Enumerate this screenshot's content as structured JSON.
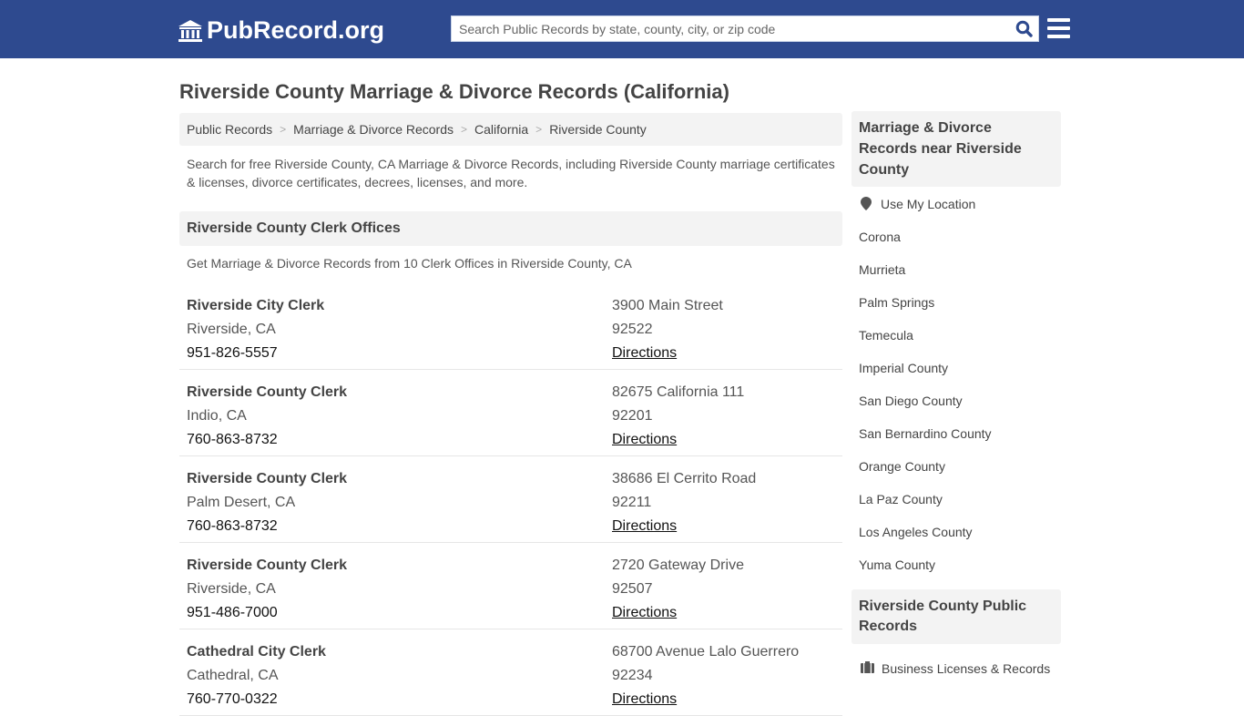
{
  "header": {
    "logo_text": "PubRecord.org",
    "search_placeholder": "Search Public Records by state, county, city, or zip code",
    "search_value": ""
  },
  "page_title": "Riverside County Marriage & Divorce Records (California)",
  "breadcrumb": [
    "Public Records",
    "Marriage & Divorce Records",
    "California",
    "Riverside County"
  ],
  "intro": "Search for free Riverside County, CA Marriage & Divorce Records, including Riverside County marriage certificates & licenses, divorce certificates, decrees, licenses, and more.",
  "clerk_section": {
    "title": "Riverside County Clerk Offices",
    "subtitle": "Get Marriage & Divorce Records from 10 Clerk Offices in Riverside County, CA",
    "offices": [
      {
        "name": "Riverside City Clerk",
        "city": "Riverside, CA",
        "phone": "951-826-5557",
        "address": "3900 Main Street",
        "zip": "92522",
        "link": "Directions"
      },
      {
        "name": "Riverside County Clerk",
        "city": "Indio, CA",
        "phone": "760-863-8732",
        "address": "82675 California 111",
        "zip": "92201",
        "link": "Directions"
      },
      {
        "name": "Riverside County Clerk",
        "city": "Palm Desert, CA",
        "phone": "760-863-8732",
        "address": "38686 El Cerrito Road",
        "zip": "92211",
        "link": "Directions"
      },
      {
        "name": "Riverside County Clerk",
        "city": "Riverside, CA",
        "phone": "951-486-7000",
        "address": "2720 Gateway Drive",
        "zip": "92507",
        "link": "Directions"
      },
      {
        "name": "Cathedral City Clerk",
        "city": "Cathedral, CA",
        "phone": "760-770-0322",
        "address": "68700 Avenue Lalo Guerrero",
        "zip": "92234",
        "link": "Directions"
      }
    ]
  },
  "sidebar": {
    "nearby_title": "Marriage & Divorce Records near Riverside County",
    "use_location": "Use My Location",
    "nearby": [
      "Corona",
      "Murrieta",
      "Palm Springs",
      "Temecula",
      "Imperial County",
      "San Diego County",
      "San Bernardino County",
      "Orange County",
      "La Paz County",
      "Los Angeles County",
      "Yuma County"
    ],
    "public_title": "Riverside County Public Records",
    "public_items": [
      "Business Licenses & Records"
    ]
  }
}
